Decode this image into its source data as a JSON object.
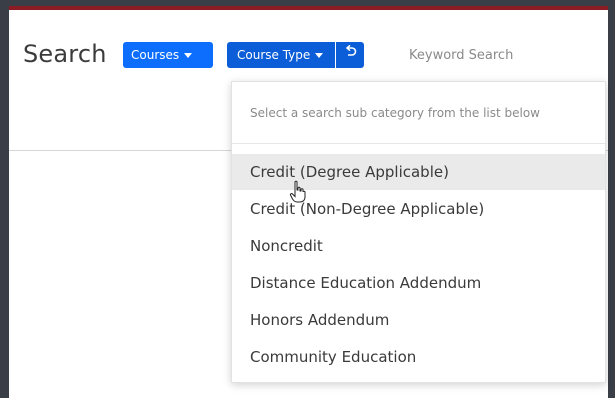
{
  "header": {
    "title": "Search",
    "courses_label": "Courses",
    "course_type_label": "Course Type",
    "reset_icon": "undo-icon",
    "keyword_placeholder": "Keyword Search"
  },
  "dropdown": {
    "header_text": "Select a search sub category from the list below",
    "items": [
      {
        "label": "Credit (Degree Applicable)",
        "highlighted": true
      },
      {
        "label": "Credit (Non-Degree Applicable)",
        "highlighted": false
      },
      {
        "label": "Noncredit",
        "highlighted": false
      },
      {
        "label": "Distance Education Addendum",
        "highlighted": false
      },
      {
        "label": "Honors Addendum",
        "highlighted": false
      },
      {
        "label": "Community Education",
        "highlighted": false
      }
    ]
  },
  "colors": {
    "accent": "#0d6efd",
    "topbar": "#8c1c24",
    "frame": "#3a3f47"
  }
}
